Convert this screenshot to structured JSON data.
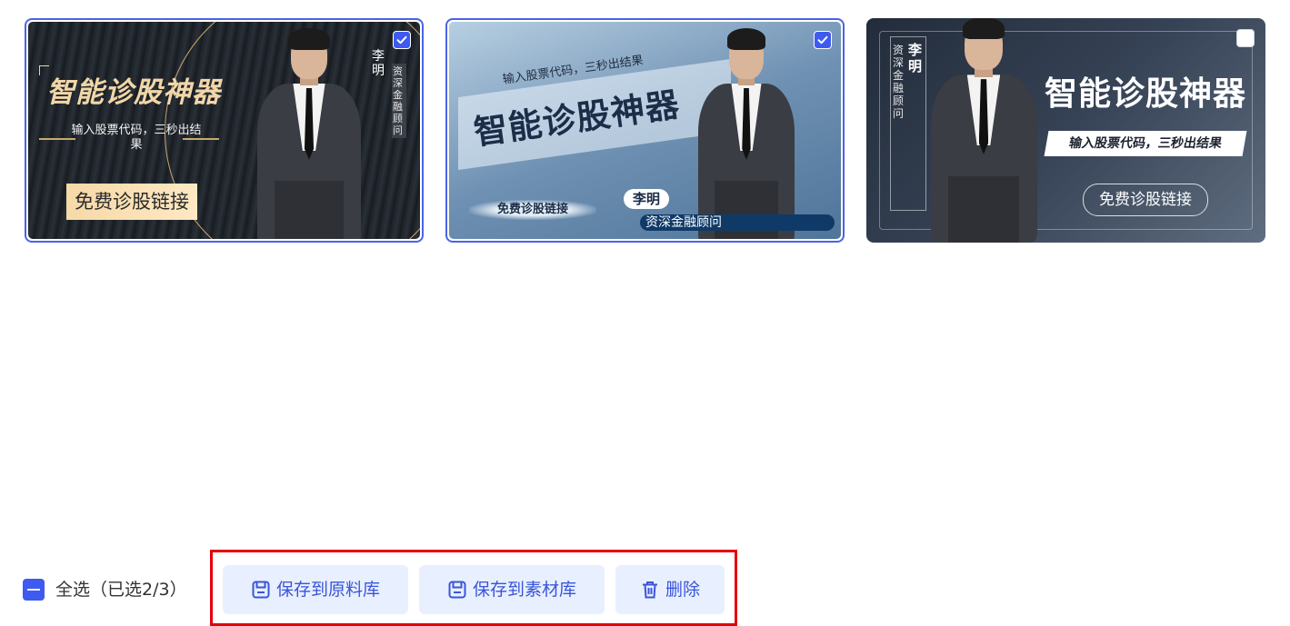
{
  "cards": [
    {
      "selected": true,
      "title": "智能诊股神器",
      "subtitle": "输入股票代码，三秒出结果",
      "button": "免费诊股链接",
      "name": "李明",
      "role": "资深金融顾问"
    },
    {
      "selected": true,
      "title": "智能诊股神器",
      "subtitle": "输入股票代码，三秒出结果",
      "button": "免费诊股链接",
      "name": "李明",
      "role": "资深金融顾问"
    },
    {
      "selected": false,
      "title": "智能诊股神器",
      "subtitle": "输入股票代码，三秒出结果",
      "button": "免费诊股链接",
      "name": "李明",
      "role": "资深金融顾问"
    }
  ],
  "footer": {
    "select_all_label": "全选（已选2/3）",
    "actions": {
      "save_raw": "保存到原料库",
      "save_material": "保存到素材库",
      "delete": "删除"
    }
  },
  "colors": {
    "accent": "#3f5af0",
    "action_bg": "#e8efff",
    "action_text": "#3a55d8",
    "highlight_box": "#e3000b"
  },
  "icons": {
    "checkbox_checked": "check-icon",
    "select_all": "minus-icon",
    "save": "save-icon",
    "delete": "trash-icon"
  }
}
